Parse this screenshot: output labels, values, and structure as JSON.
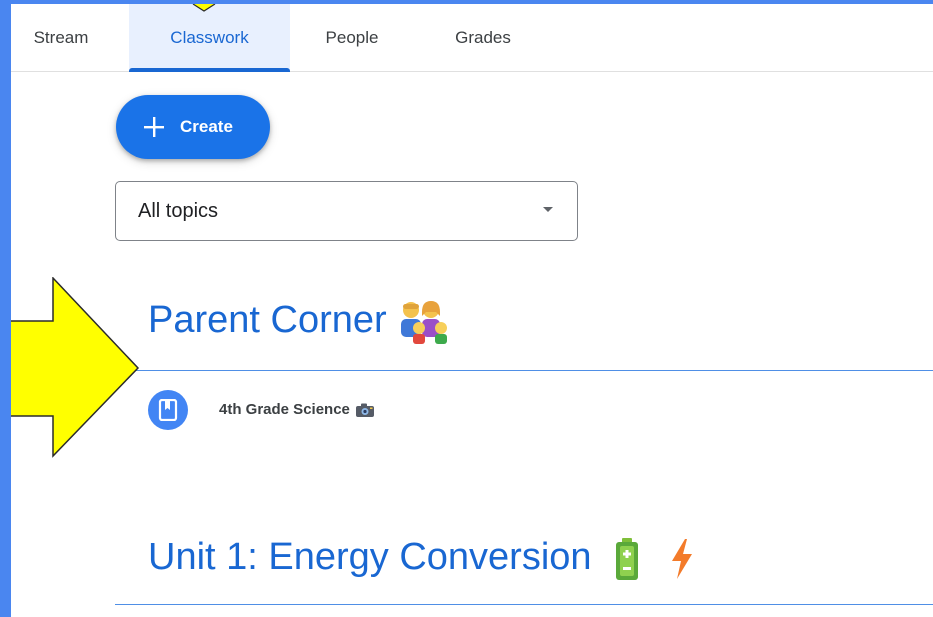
{
  "tabs": [
    {
      "label": "Stream",
      "active": false
    },
    {
      "label": "Classwork",
      "active": true
    },
    {
      "label": "People",
      "active": false
    },
    {
      "label": "Grades",
      "active": false
    }
  ],
  "create_button": {
    "label": "Create",
    "icon": "plus-icon"
  },
  "topic_filter": {
    "value": "All topics",
    "icon": "dropdown-caret-icon"
  },
  "sections": [
    {
      "title": "Parent Corner",
      "emoji_icon": "family-emoji-icon",
      "items": [
        {
          "title": "4th Grade Science",
          "icon": "book-icon",
          "trailing_icon": "camera-emoji-icon"
        }
      ]
    },
    {
      "title": "Unit 1: Energy Conversion",
      "emoji_icons": [
        "battery-emoji-icon",
        "lightning-emoji-icon"
      ]
    }
  ],
  "annotation": {
    "icon": "yellow-arrow-icon",
    "color": "#ffff00"
  },
  "colors": {
    "accent": "#1967d2",
    "button": "#1a73e8",
    "frame": "#4a86f0"
  }
}
